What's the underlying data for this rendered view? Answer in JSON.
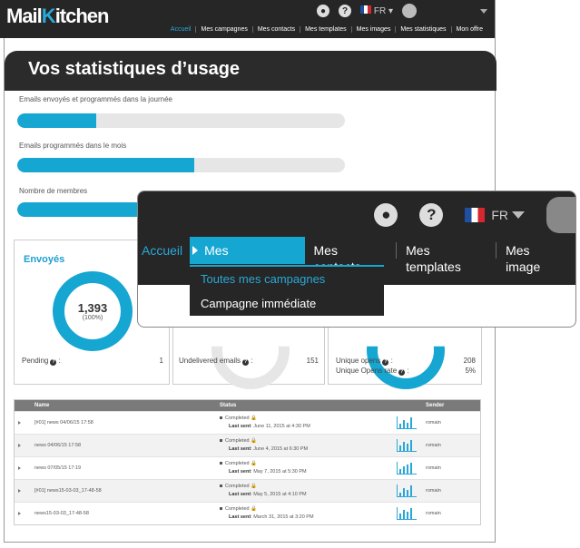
{
  "app": {
    "logo_main": "Mail",
    "logo_k": "K",
    "logo_rest": "itchen"
  },
  "topbar": {
    "lang": "FR",
    "help": "?"
  },
  "nav": [
    "Accueil",
    "Mes campagnes",
    "Mes contacts",
    "Mes templates",
    "Mes images",
    "Mes statistiques",
    "Mon offre"
  ],
  "page_title": "Vos statistiques d’usage",
  "usage_bars": [
    {
      "label": "Emails envoyés et programmés dans la journée",
      "fill_fraction": 0.24
    },
    {
      "label": "Emails programmés dans le mois",
      "fill_fraction": 0.54
    },
    {
      "label": "Nombre de membres",
      "fill_fraction": 0.45
    }
  ],
  "cards": {
    "sent": {
      "title": "Envoyés",
      "value": "1,393",
      "percent": "(100%)",
      "pending_label": "Pending",
      "pending_value": "1"
    },
    "undelivered": {
      "label": "Undelivered emails",
      "value": "151"
    },
    "opens": {
      "unique_label": "Unique opens",
      "unique_value": "208",
      "rate_label": "Unique Opens rate",
      "rate_value": "5%"
    }
  },
  "table": {
    "headers": {
      "name": "Name",
      "status": "Status",
      "sender": "Sender"
    },
    "rows": [
      {
        "name": "[#01] news 04/06/15 17:58",
        "status": "Completed",
        "last_sent_label": "Last sent",
        "last_sent": ": June 11, 2015 at 4:30 PM",
        "sender": "romain"
      },
      {
        "name": "news 04/06/15 17:58",
        "status": "Completed",
        "last_sent_label": "Last sent",
        "last_sent": ": June 4, 2015 at 6:30 PM",
        "sender": "romain"
      },
      {
        "name": "news 07/05/15 17:19",
        "status": "Completed",
        "last_sent_label": "Last sent",
        "last_sent": ": May 7, 2015 at 5:30 PM",
        "sender": "romain"
      },
      {
        "name": "[#01] news15-03-03_17-48-58",
        "status": "Completed",
        "last_sent_label": "Last sent",
        "last_sent": ": May 5, 2015 at 4:10 PM",
        "sender": "romain"
      },
      {
        "name": "news15-03-03_17-48-58",
        "status": "Completed",
        "last_sent_label": "Last sent",
        "last_sent": ": March 31, 2015 at 3:20 PM",
        "sender": "romain"
      }
    ]
  },
  "zoom": {
    "nav": {
      "home": "Accueil",
      "active": "Mes campagnes",
      "contacts": "Mes contacts",
      "templates": "Mes templates",
      "images": "Mes image"
    },
    "lang": "FR",
    "help": "?",
    "dropdown": [
      "Toutes mes campagnes",
      "Campagne immédiate"
    ]
  }
}
